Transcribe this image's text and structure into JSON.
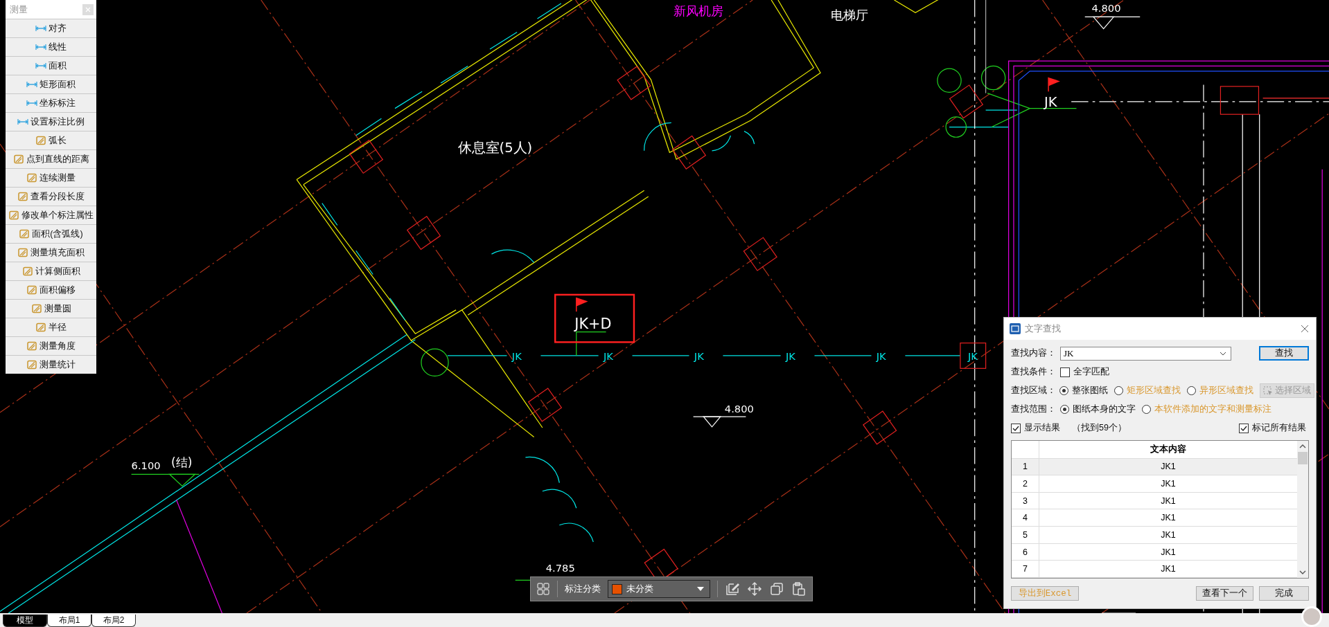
{
  "measure_panel": {
    "title": "测量",
    "items": [
      {
        "label": "对齐",
        "kind": "dimension"
      },
      {
        "label": "线性",
        "kind": "dimension"
      },
      {
        "label": "面积",
        "kind": "dimension"
      },
      {
        "label": "矩形面积",
        "kind": "dimension"
      },
      {
        "label": "坐标标注",
        "kind": "dimension"
      },
      {
        "label": "设置标注比例",
        "kind": "dimension"
      },
      {
        "label": "弧长",
        "kind": "tool"
      },
      {
        "label": "点到直线的距离",
        "kind": "tool"
      },
      {
        "label": "连续测量",
        "kind": "tool"
      },
      {
        "label": "查看分段长度",
        "kind": "tool"
      },
      {
        "label": "修改单个标注属性",
        "kind": "tool"
      },
      {
        "label": "面积(含弧线)",
        "kind": "tool"
      },
      {
        "label": "测量填充面积",
        "kind": "tool"
      },
      {
        "label": "计算侧面积",
        "kind": "tool"
      },
      {
        "label": "面积偏移",
        "kind": "tool"
      },
      {
        "label": "测量圆",
        "kind": "tool"
      },
      {
        "label": "半径",
        "kind": "tool"
      },
      {
        "label": "测量角度",
        "kind": "tool"
      },
      {
        "label": "测量统计",
        "kind": "tool"
      }
    ]
  },
  "drawing": {
    "labels": [
      {
        "text": "新风机房",
        "color": "#ff00ff"
      },
      {
        "text": "电梯厅",
        "color": "#ffffff"
      },
      {
        "text": "4.800",
        "color": "#ffffff"
      },
      {
        "text": "休息室(5人)",
        "color": "#ffffff"
      },
      {
        "text": "JK",
        "color": "#ffffff"
      },
      {
        "text": "JK+D",
        "color": "#ffffff"
      },
      {
        "text": "JK",
        "color": "#00e5e5"
      },
      {
        "text": "JK",
        "color": "#00e5e5"
      },
      {
        "text": "JK",
        "color": "#00e5e5"
      },
      {
        "text": "JK",
        "color": "#00e5e5"
      },
      {
        "text": "JK",
        "color": "#00e5e5"
      },
      {
        "text": "JK",
        "color": "#00e5e5"
      },
      {
        "text": "4.800",
        "color": "#ffffff"
      },
      {
        "text": "6.100",
        "color": "#ffffff"
      },
      {
        "text": "(结)",
        "color": "#ffffff"
      },
      {
        "text": "4.785",
        "color": "#ffffff"
      }
    ]
  },
  "find_dialog": {
    "title": "文字查找",
    "content_label": "查找内容：",
    "content_value": "JK",
    "find_button": "查找",
    "condition_label": "查找条件：",
    "whole_word": {
      "label": "全字匹配",
      "checked": false
    },
    "area_label": "查找区域：",
    "area_options": [
      {
        "label": "整张图纸",
        "selected": true
      },
      {
        "label": "矩形区域查找",
        "selected": false
      },
      {
        "label": "异形区域查找",
        "selected": false
      }
    ],
    "select_area_button": {
      "label": "选择区域",
      "disabled": true
    },
    "scope_label": "查找范围：",
    "scope_options": [
      {
        "label": "图纸本身的文字",
        "selected": true
      },
      {
        "label": "本软件添加的文字和测量标注",
        "selected": false
      }
    ],
    "show_results": {
      "label": "显示结果",
      "checked": true
    },
    "found_count": "（找到59个）",
    "mark_all": {
      "label": "标记所有结果",
      "checked": true
    },
    "table": {
      "columns": [
        "文本内容"
      ],
      "rows": [
        {
          "index": "1",
          "text": "JK1",
          "selected": true
        },
        {
          "index": "2",
          "text": "JK1",
          "selected": false
        },
        {
          "index": "3",
          "text": "JK1",
          "selected": false
        },
        {
          "index": "4",
          "text": "JK1",
          "selected": false
        },
        {
          "index": "5",
          "text": "JK1",
          "selected": false
        },
        {
          "index": "6",
          "text": "JK1",
          "selected": false
        },
        {
          "index": "7",
          "text": "JK1",
          "selected": false
        }
      ]
    },
    "export_button": "导出到Excel",
    "next_button": "查看下一个",
    "done_button": "完成"
  },
  "annotation_toolbar": {
    "label": "标注分类",
    "category": {
      "name": "未分类",
      "color": "#e65100"
    }
  },
  "layout_tabs": [
    {
      "label": "模型",
      "selected": true
    },
    {
      "label": "布局1",
      "selected": false
    },
    {
      "label": "布局2",
      "selected": false
    }
  ]
}
